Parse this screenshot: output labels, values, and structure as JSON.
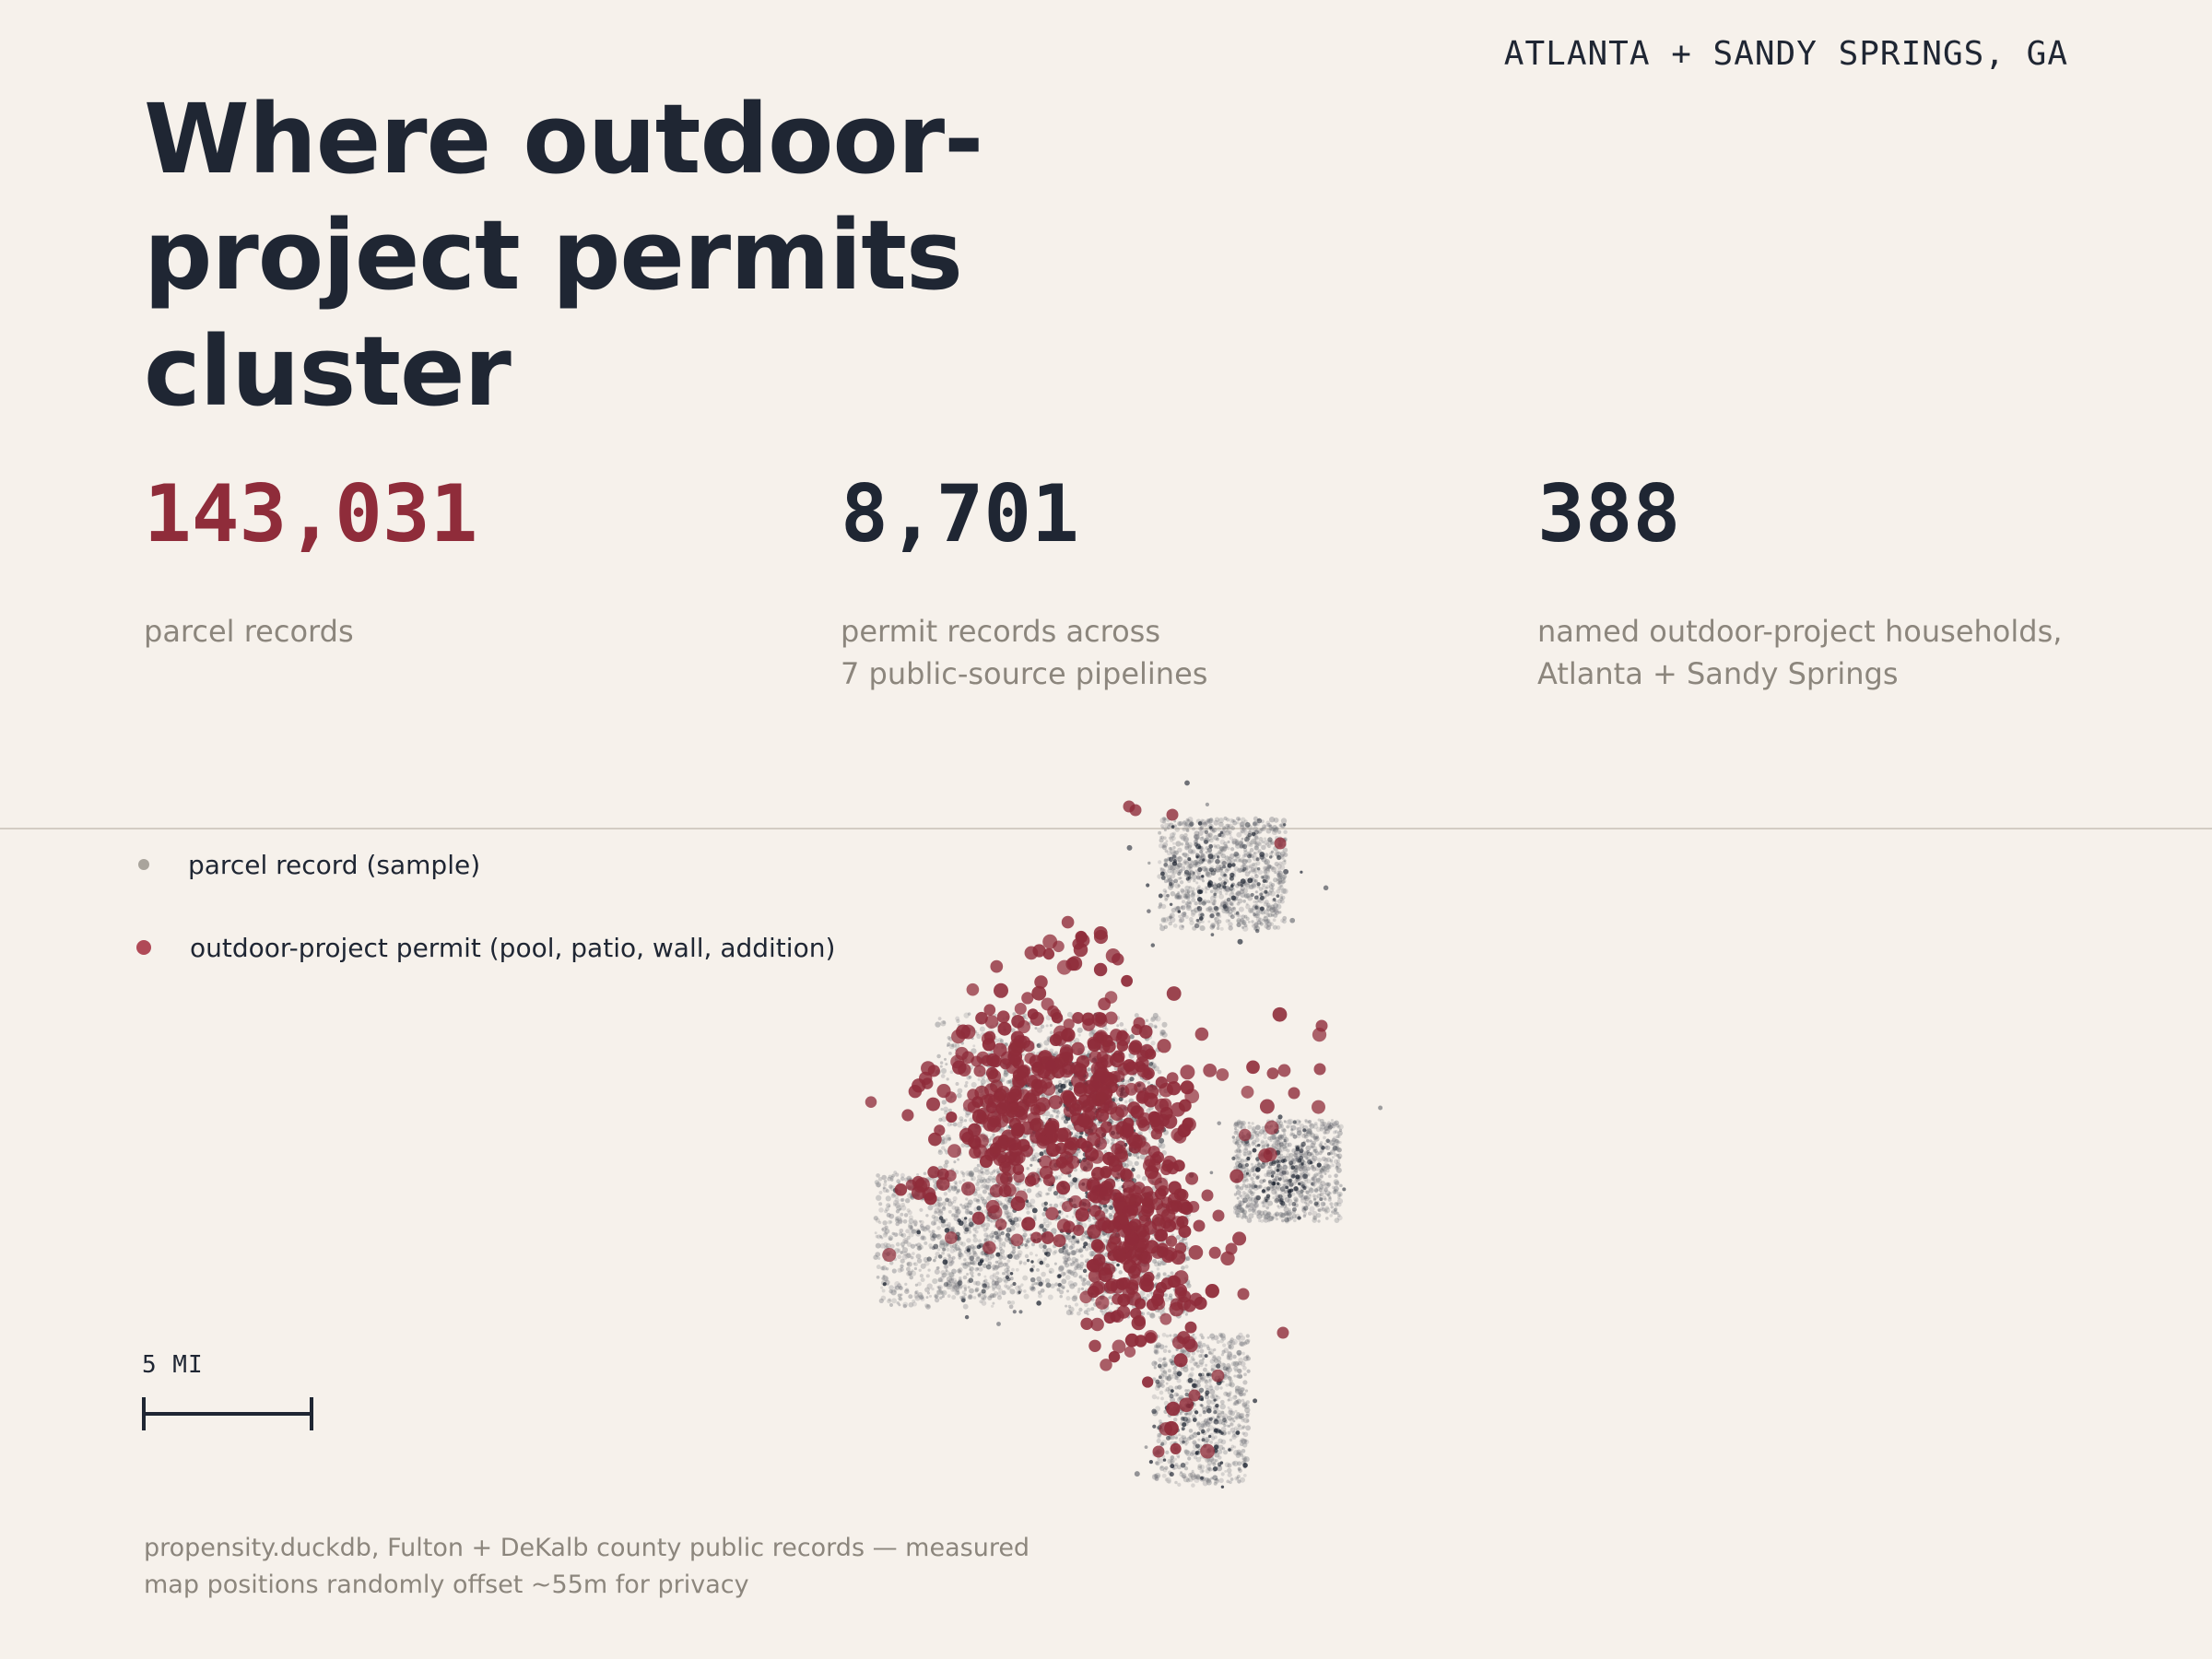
{
  "header": {
    "location": "ATLANTA + SANDY SPRINGS, GA",
    "title": "Where outdoor-project permits cluster"
  },
  "stats": [
    {
      "value": "143,031",
      "label": "parcel records"
    },
    {
      "value": "8,701",
      "label": "permit records across\n7 public-source pipelines"
    },
    {
      "value": "388",
      "label": "named outdoor-project households,\nAtlanta + Sandy Springs"
    }
  ],
  "legend": {
    "parcel": "parcel record (sample)",
    "permit": "outdoor-project permit (pool, patio, wall, addition)"
  },
  "scale": {
    "label": "5 MI"
  },
  "source": {
    "line1": "propensity.duckdb, Fulton + DeKalb county public records — measured",
    "line2": "map positions randomly offset ~55m for privacy"
  },
  "colors": {
    "background": "#f6f1eb",
    "text": "#1f2633",
    "muted": "#8c867d",
    "accent": "#8f2c3a",
    "parcel_dot": "#a9a49c",
    "permit_dot": "#b04a57",
    "divider": "#d3ccc3"
  }
}
